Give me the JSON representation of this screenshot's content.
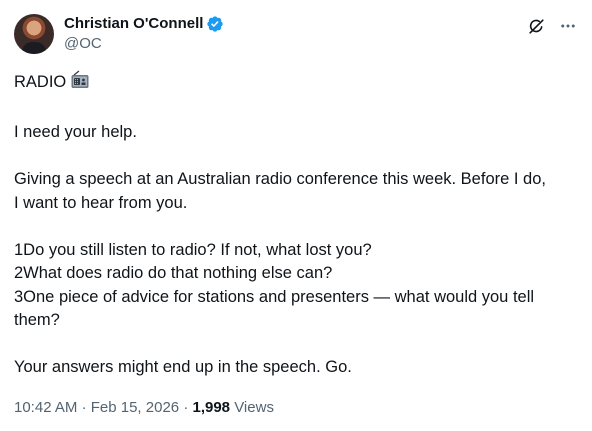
{
  "author": {
    "display_name": "Christian O'Connell",
    "handle": "@OC",
    "verified": true,
    "verified_color": "#1d9bf0"
  },
  "header_actions": {
    "grok_icon": "grok-icon",
    "more_icon": "more-icon"
  },
  "tweet": {
    "title_text": "RADIO",
    "title_emoji": "radio-emoji",
    "p1": "I need your help.",
    "p2_line1": "Giving a speech at an Australian radio conference this week. Before I do,",
    "p2_line2": "I want to hear from you.",
    "q1": "1Do you still listen to radio? If not, what lost you?",
    "q2": "2What does radio do that nothing else can?",
    "q3_line1": "3One piece of advice for stations and presenters — what would you tell",
    "q3_line2": "them?",
    "closing": "Your answers might end up in the speech. Go."
  },
  "meta": {
    "time": "10:42 AM",
    "separator": "·",
    "date": "Feb 15, 2026",
    "separator2": "·",
    "views_count": "1,998",
    "views_label": "Views"
  }
}
